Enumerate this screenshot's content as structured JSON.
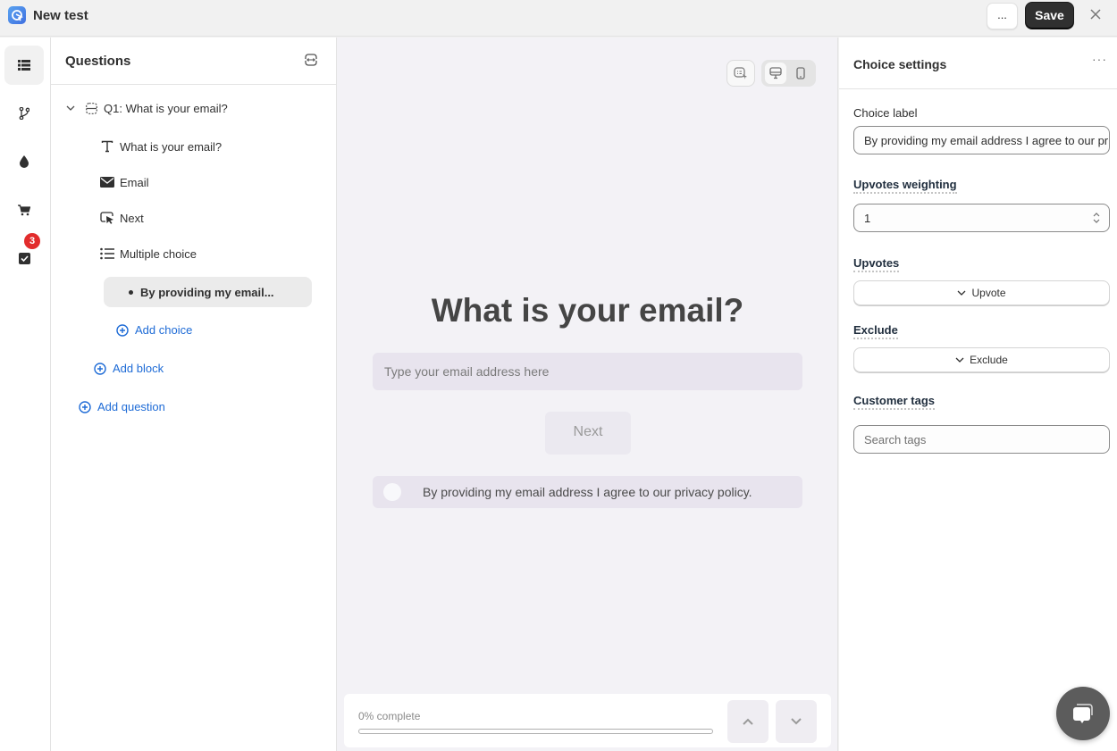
{
  "topbar": {
    "title": "New test",
    "more_label": "...",
    "save_label": "Save",
    "close_icon": "close-icon",
    "logo_icon": "app-logo-icon"
  },
  "rail": {
    "items": [
      {
        "icon": "list-icon",
        "active": true
      },
      {
        "icon": "branch-icon",
        "active": false
      },
      {
        "icon": "droplet-icon",
        "active": false
      },
      {
        "icon": "cart-icon",
        "active": false
      },
      {
        "icon": "checkbox-icon",
        "active": false,
        "badge": "3"
      }
    ]
  },
  "questions": {
    "title": "Questions",
    "tree": {
      "question": "Q1: What is your email?",
      "blocks": [
        {
          "icon": "text-icon",
          "label": "What is your email?"
        },
        {
          "icon": "envelope-icon",
          "label": "Email"
        },
        {
          "icon": "cursor-click-icon",
          "label": "Next"
        },
        {
          "icon": "list-bullets-icon",
          "label": "Multiple choice"
        }
      ],
      "selected_choice": "By providing my email...",
      "add_choice": "Add choice",
      "add_block": "Add block",
      "add_question": "Add question"
    }
  },
  "preview": {
    "heading": "What is your email?",
    "email_placeholder": "Type your email address here",
    "next_label": "Next",
    "choice_text": "By providing my email address I agree to our privacy policy.",
    "progress_label": "0% complete",
    "progress_percent": 0
  },
  "settings": {
    "title": "Choice settings",
    "more_label": "···",
    "choice_label_title": "Choice label",
    "choice_label_value": "By providing my email address I agree to our privacy policy.",
    "upvotes_weighting_title": "Upvotes weighting",
    "upvotes_weighting_value": "1",
    "upvotes_title": "Upvotes",
    "upvotes_button": "Upvote",
    "exclude_title": "Exclude",
    "exclude_button": "Exclude",
    "customer_tags_title": "Customer tags",
    "customer_tags_placeholder": "Search tags"
  },
  "colors": {
    "accent_link": "#1e6bd6",
    "save_button": "#303030",
    "badge": "#e22c2c",
    "canvas_bg": "#f3f2f6"
  }
}
